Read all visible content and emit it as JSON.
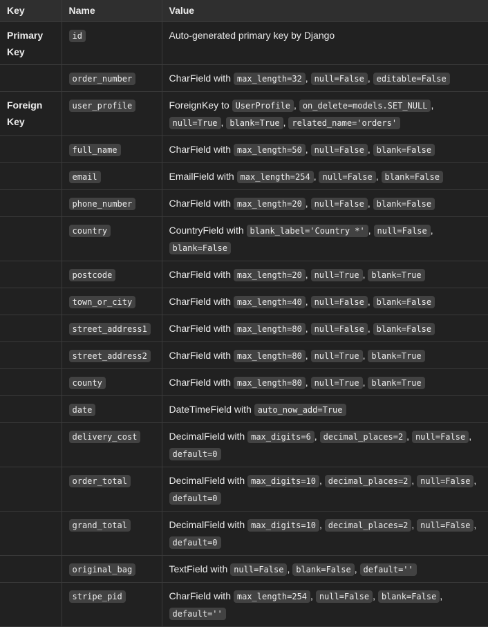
{
  "headers": [
    "Key",
    "Name",
    "Value"
  ],
  "rows": [
    {
      "key": "Primary Key",
      "name": "id",
      "value": [
        {
          "t": "Auto-generated primary key by Django"
        }
      ]
    },
    {
      "key": "",
      "name": "order_number",
      "value": [
        {
          "t": "CharField with "
        },
        {
          "c": "max_length=32"
        },
        {
          "t": ", "
        },
        {
          "c": "null=False"
        },
        {
          "t": ", "
        },
        {
          "c": "editable=False"
        }
      ]
    },
    {
      "key": "Foreign Key",
      "name": "user_profile",
      "value": [
        {
          "t": "ForeignKey to "
        },
        {
          "c": "UserProfile"
        },
        {
          "t": ", "
        },
        {
          "c": "on_delete=models.SET_NULL"
        },
        {
          "t": ", "
        },
        {
          "c": "null=True"
        },
        {
          "t": ", "
        },
        {
          "c": "blank=True"
        },
        {
          "t": ", "
        },
        {
          "c": "related_name='orders'"
        }
      ]
    },
    {
      "key": "",
      "name": "full_name",
      "value": [
        {
          "t": "CharField with "
        },
        {
          "c": "max_length=50"
        },
        {
          "t": ", "
        },
        {
          "c": "null=False"
        },
        {
          "t": ", "
        },
        {
          "c": "blank=False"
        }
      ]
    },
    {
      "key": "",
      "name": "email",
      "value": [
        {
          "t": "EmailField with "
        },
        {
          "c": "max_length=254"
        },
        {
          "t": ", "
        },
        {
          "c": "null=False"
        },
        {
          "t": ", "
        },
        {
          "c": "blank=False"
        }
      ]
    },
    {
      "key": "",
      "name": "phone_number",
      "value": [
        {
          "t": "CharField with "
        },
        {
          "c": "max_length=20"
        },
        {
          "t": ", "
        },
        {
          "c": "null=False"
        },
        {
          "t": ", "
        },
        {
          "c": "blank=False"
        }
      ]
    },
    {
      "key": "",
      "name": "country",
      "value": [
        {
          "t": "CountryField with "
        },
        {
          "c": "blank_label='Country *'"
        },
        {
          "t": ", "
        },
        {
          "c": "null=False"
        },
        {
          "t": ", "
        },
        {
          "c": "blank=False"
        }
      ]
    },
    {
      "key": "",
      "name": "postcode",
      "value": [
        {
          "t": "CharField with "
        },
        {
          "c": "max_length=20"
        },
        {
          "t": ", "
        },
        {
          "c": "null=True"
        },
        {
          "t": ", "
        },
        {
          "c": "blank=True"
        }
      ]
    },
    {
      "key": "",
      "name": "town_or_city",
      "value": [
        {
          "t": "CharField with "
        },
        {
          "c": "max_length=40"
        },
        {
          "t": ", "
        },
        {
          "c": "null=False"
        },
        {
          "t": ", "
        },
        {
          "c": "blank=False"
        }
      ]
    },
    {
      "key": "",
      "name": "street_address1",
      "value": [
        {
          "t": "CharField with "
        },
        {
          "c": "max_length=80"
        },
        {
          "t": ", "
        },
        {
          "c": "null=False"
        },
        {
          "t": ", "
        },
        {
          "c": "blank=False"
        }
      ]
    },
    {
      "key": "",
      "name": "street_address2",
      "value": [
        {
          "t": "CharField with "
        },
        {
          "c": "max_length=80"
        },
        {
          "t": ", "
        },
        {
          "c": "null=True"
        },
        {
          "t": ", "
        },
        {
          "c": "blank=True"
        }
      ]
    },
    {
      "key": "",
      "name": "county",
      "value": [
        {
          "t": "CharField with "
        },
        {
          "c": "max_length=80"
        },
        {
          "t": ", "
        },
        {
          "c": "null=True"
        },
        {
          "t": ", "
        },
        {
          "c": "blank=True"
        }
      ]
    },
    {
      "key": "",
      "name": "date",
      "value": [
        {
          "t": "DateTimeField with "
        },
        {
          "c": "auto_now_add=True"
        }
      ]
    },
    {
      "key": "",
      "name": "delivery_cost",
      "value": [
        {
          "t": "DecimalField with "
        },
        {
          "c": "max_digits=6"
        },
        {
          "t": ", "
        },
        {
          "c": "decimal_places=2"
        },
        {
          "t": ", "
        },
        {
          "c": "null=False"
        },
        {
          "t": ", "
        },
        {
          "c": "default=0"
        }
      ]
    },
    {
      "key": "",
      "name": "order_total",
      "value": [
        {
          "t": "DecimalField with "
        },
        {
          "c": "max_digits=10"
        },
        {
          "t": ", "
        },
        {
          "c": "decimal_places=2"
        },
        {
          "t": ", "
        },
        {
          "c": "null=False"
        },
        {
          "t": ", "
        },
        {
          "c": "default=0"
        }
      ]
    },
    {
      "key": "",
      "name": "grand_total",
      "value": [
        {
          "t": "DecimalField with "
        },
        {
          "c": "max_digits=10"
        },
        {
          "t": ", "
        },
        {
          "c": "decimal_places=2"
        },
        {
          "t": ", "
        },
        {
          "c": "null=False"
        },
        {
          "t": ", "
        },
        {
          "c": "default=0"
        }
      ]
    },
    {
      "key": "",
      "name": "original_bag",
      "value": [
        {
          "t": "TextField with "
        },
        {
          "c": "null=False"
        },
        {
          "t": ", "
        },
        {
          "c": "blank=False"
        },
        {
          "t": ", "
        },
        {
          "c": "default=''"
        }
      ]
    },
    {
      "key": "",
      "name": "stripe_pid",
      "value": [
        {
          "t": "CharField with "
        },
        {
          "c": "max_length=254"
        },
        {
          "t": ", "
        },
        {
          "c": "null=False"
        },
        {
          "t": ", "
        },
        {
          "c": "blank=False"
        },
        {
          "t": ", "
        },
        {
          "c": "default=''"
        }
      ]
    }
  ]
}
